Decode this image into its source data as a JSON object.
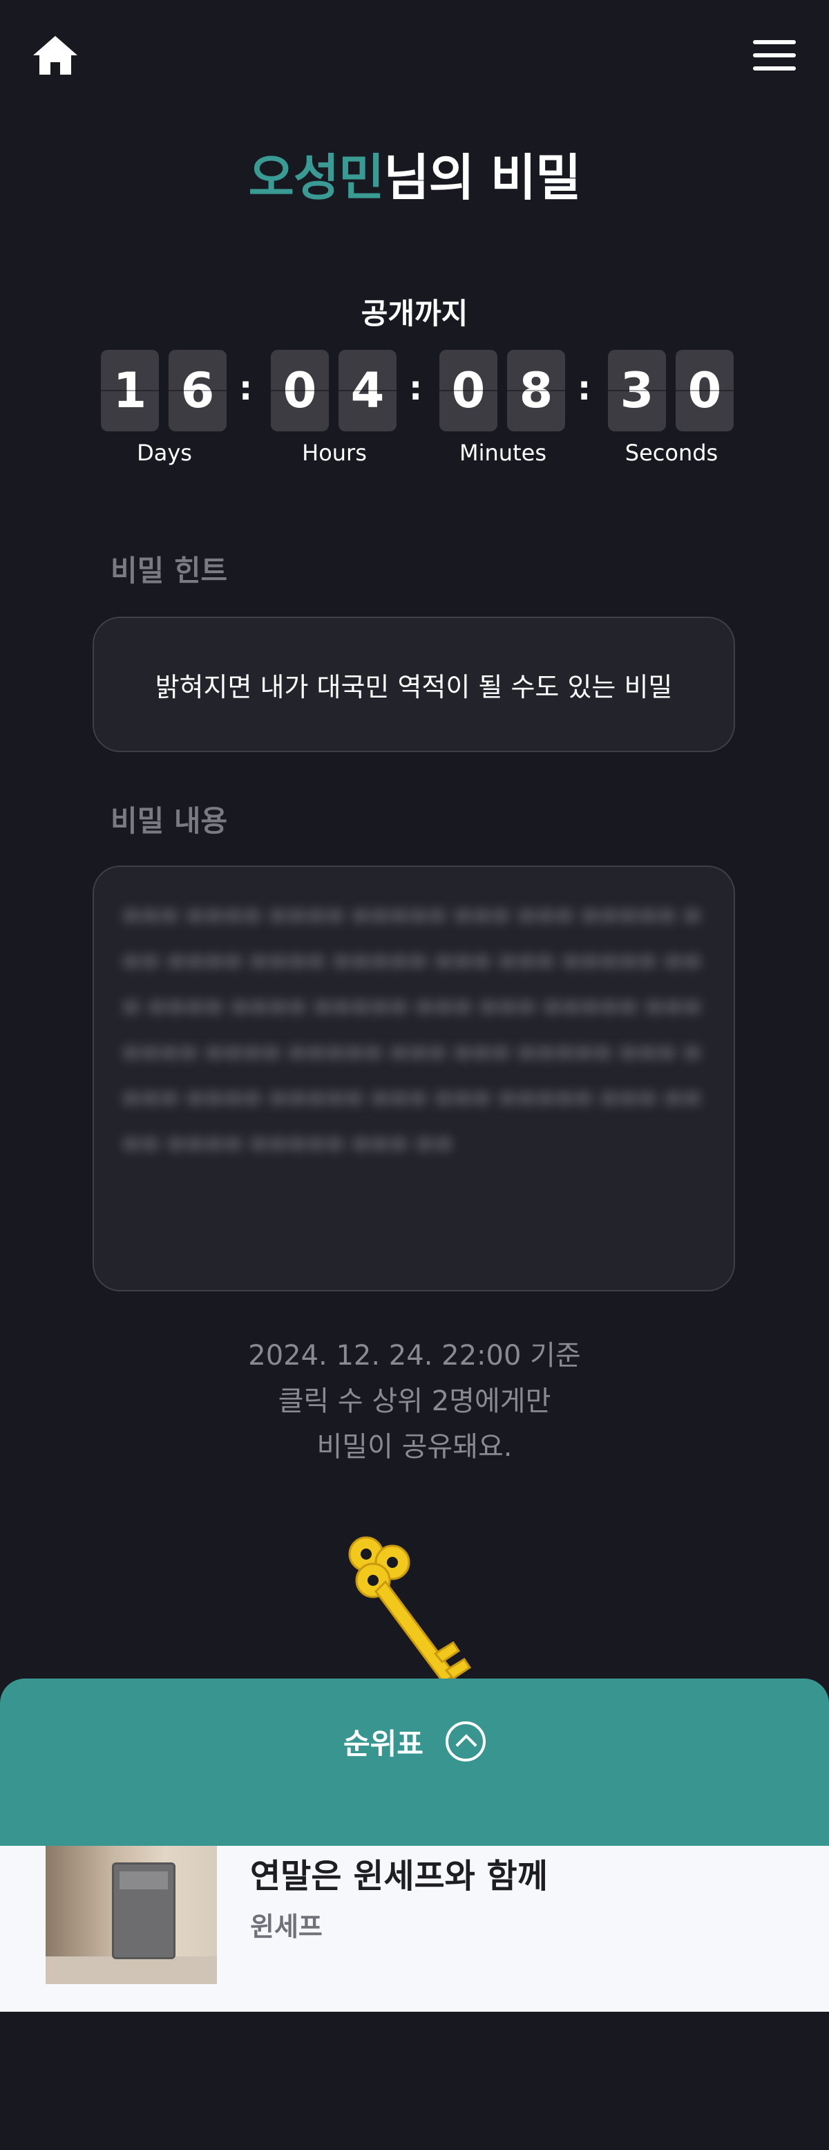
{
  "header": {
    "home_icon": "home-icon",
    "menu_icon": "hamburger-menu-icon"
  },
  "title": {
    "name": "오성민",
    "suffix": "님의 비밀"
  },
  "countdown": {
    "label": "공개까지",
    "days": [
      "1",
      "6"
    ],
    "hours": [
      "0",
      "4"
    ],
    "minutes": [
      "0",
      "8"
    ],
    "seconds": [
      "3",
      "0"
    ],
    "units": {
      "days": "Days",
      "hours": "Hours",
      "minutes": "Minutes",
      "seconds": "Seconds"
    }
  },
  "hint": {
    "label": "비밀 힌트",
    "text": "밝혀지면 내가 대국민 역적이 될 수도 있는 비밀"
  },
  "content": {
    "label": "비밀 내용"
  },
  "notice": {
    "line1": "2024. 12. 24. 22:00 기준",
    "line2": "클릭 수 상위 2명에게만",
    "line3": "비밀이 공유돼요."
  },
  "ranking": {
    "label": "순위표",
    "toggle_icon": "chevron-up-icon"
  },
  "ad": {
    "title": "연말은 윈세프와 함께",
    "brand": "윈세프"
  },
  "colors": {
    "accent": "#3a9a94",
    "panel": "#389590",
    "background": "#181820"
  }
}
